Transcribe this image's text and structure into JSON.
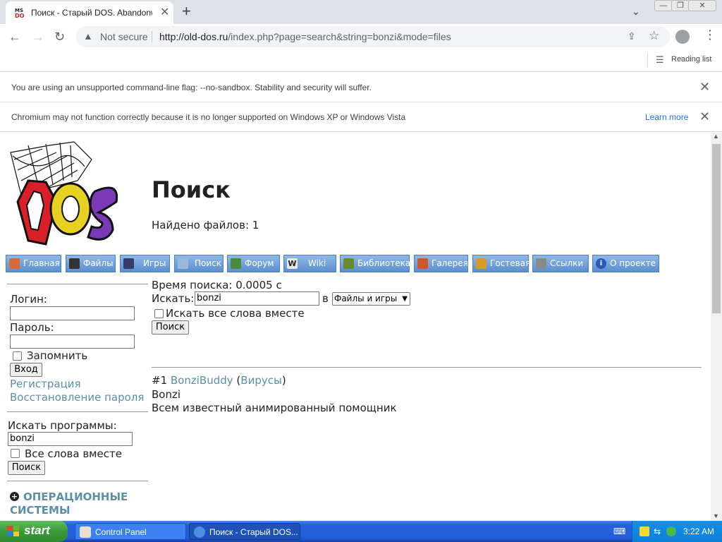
{
  "browser": {
    "tab_title": "Поиск - Старый DOS. Abandonware",
    "tab_close": "✕",
    "new_tab": "+",
    "tab_search": "⌄",
    "window_min": "—",
    "window_max": "❐",
    "window_close": "✕",
    "back": "←",
    "forward": "→",
    "reload": "↻",
    "security_label": "Not secure",
    "url_host": "http://old-dos.ru",
    "url_path": "/index.php?page=search&string=bonzi&mode=files",
    "reading_list": "Reading list",
    "menu": "⋮"
  },
  "infobars": [
    {
      "message": "You are using an unsupported command-line flag: --no-sandbox. Stability and security will suffer.",
      "close": "✕"
    },
    {
      "message": "Chromium may not function correctly because it is no longer supported on Windows XP or Windows Vista",
      "link": "Learn more",
      "close": "✕"
    }
  ],
  "page": {
    "heading": "Поиск",
    "found_files": "Найдено файлов: 1",
    "nav": [
      {
        "label": "Главная",
        "icon": "home-icon",
        "color": "#d86a3a"
      },
      {
        "label": "Файлы",
        "icon": "terminal-icon",
        "color": "#333333"
      },
      {
        "label": "Игры",
        "icon": "invader-icon",
        "color": "#3a3a6a"
      },
      {
        "label": "Поиск",
        "icon": "magnifier-icon",
        "color": "#9ab8d8"
      },
      {
        "label": "Форум",
        "icon": "person-icon",
        "color": "#4a8a3a"
      },
      {
        "label": "Wiki",
        "icon": "wiki-icon",
        "color": "#e8e8e8"
      },
      {
        "label": "Библиотека",
        "icon": "book-icon",
        "color": "#6a8a2a"
      },
      {
        "label": "Галерея",
        "icon": "picture-icon",
        "color": "#c85a2a"
      },
      {
        "label": "Гостевая",
        "icon": "guestbook-icon",
        "color": "#d89a2a"
      },
      {
        "label": "Ссылки",
        "icon": "link-icon",
        "color": "#8a8a8a"
      },
      {
        "label": "О проекте",
        "icon": "info-icon",
        "color": "#2a5ab8"
      }
    ],
    "search": {
      "time": "Время поиска: 0.0005 с",
      "label": "Искать:",
      "value": "bonzi",
      "in_label": "в",
      "scope": "Файлы и игры",
      "all_words": "Искать все слова вместе",
      "button": "Поиск"
    },
    "result": {
      "number": "#1",
      "title": "BonziBuddy",
      "open_paren": "(",
      "category": "Вирусы",
      "close_paren": ")",
      "name": "Bonzi",
      "description": "Всем известный анимированный помощник"
    },
    "sidebar": {
      "login_label": "Логин:",
      "password_label": "Пароль:",
      "remember": "Запомнить",
      "login_button": "Вход",
      "register": "Регистрация",
      "restore": "Восстановление пароля",
      "search_label": "Искать программы:",
      "search_value": "bonzi",
      "all_words": "Все слова вместе",
      "search_button": "Поиск",
      "os_heading_1": "ОПЕРАЦИОННЫЕ",
      "os_heading_2": "СИСТЕМЫ"
    }
  },
  "taskbar": {
    "start": "start",
    "tasks": [
      {
        "label": "Control Panel",
        "active": false
      },
      {
        "label": "Поиск - Старый DOS...",
        "active": true
      }
    ],
    "clock": "3:22 AM"
  }
}
